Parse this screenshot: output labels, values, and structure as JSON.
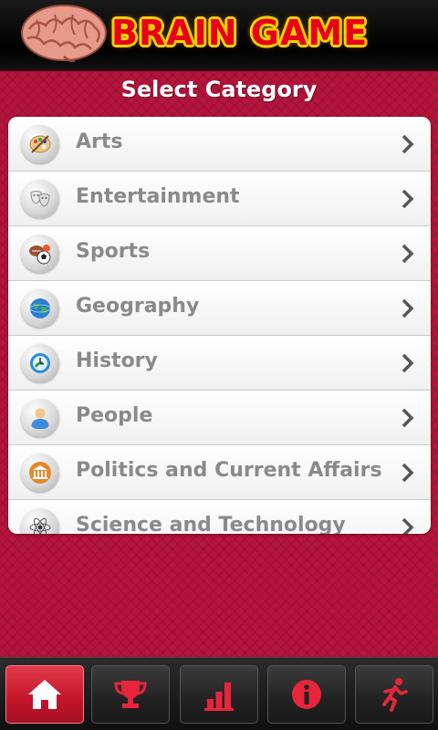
{
  "app": {
    "title": "BRAIN GAME",
    "logo_icon": "brain-icon"
  },
  "page": {
    "section_title": "Select Category"
  },
  "categories": [
    {
      "label": "Arts",
      "icon": "palette-icon"
    },
    {
      "label": "Entertainment",
      "icon": "theater-masks-icon"
    },
    {
      "label": "Sports",
      "icon": "sports-balls-icon"
    },
    {
      "label": "Geography",
      "icon": "globe-icon"
    },
    {
      "label": "History",
      "icon": "clock-icon"
    },
    {
      "label": "People",
      "icon": "person-icon"
    },
    {
      "label": "Politics and Current Affairs",
      "icon": "government-building-icon"
    },
    {
      "label": "Science and Technology",
      "icon": "atom-icon"
    }
  ],
  "tabbar": {
    "tabs": [
      {
        "icon": "home-icon",
        "active": true
      },
      {
        "icon": "trophy-icon",
        "active": false
      },
      {
        "icon": "bar-chart-icon",
        "active": false
      },
      {
        "icon": "info-icon",
        "active": false
      },
      {
        "icon": "running-man-icon",
        "active": false
      }
    ]
  },
  "colors": {
    "brand_red": "#b5143c",
    "title_red": "#e8001a",
    "title_yellow": "#ffd200",
    "active_tab": "#c4142b",
    "icon_red": "#e8253a"
  }
}
